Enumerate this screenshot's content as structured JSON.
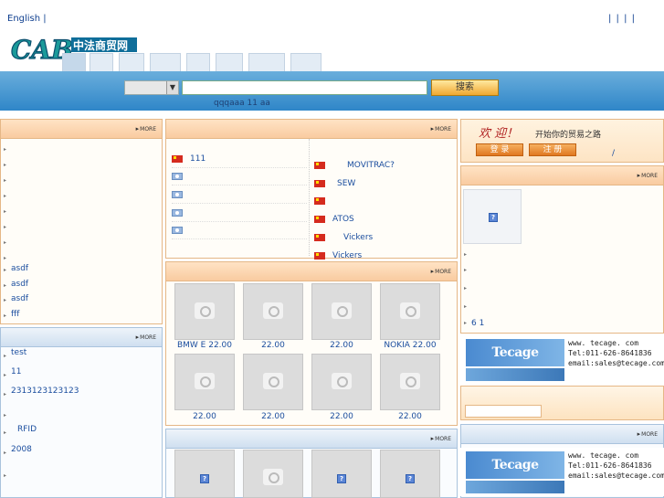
{
  "topbar": {
    "language": "English |",
    "separators": "|    |    |    |"
  },
  "logo": {
    "text": "CAB",
    "chinese": "中法商贸网"
  },
  "search": {
    "button_label": "搜索",
    "hot_words": "qqqaaa    11    aa"
  },
  "left_panel1": {
    "more": "MORE",
    "items": [
      "",
      "",
      "",
      "",
      "",
      "",
      "",
      "",
      "asdf",
      "asdf",
      "asdf",
      "fff"
    ]
  },
  "left_panel2": {
    "more": "MORE",
    "items": [
      "test",
      "11",
      "2313123123123",
      "",
      "RFID",
      "2008",
      ""
    ]
  },
  "mid_panel1": {
    "more": "MORE",
    "left_items": [
      {
        "flag": "cn",
        "text": "111"
      },
      {
        "flag": "un",
        "text": ""
      },
      {
        "flag": "un",
        "text": ""
      },
      {
        "flag": "un",
        "text": ""
      },
      {
        "flag": "un",
        "text": ""
      }
    ],
    "right_items": [
      {
        "flag": "cn",
        "text": "MOVITRAC?"
      },
      {
        "flag": "cn",
        "text": "SEW"
      },
      {
        "flag": "cn",
        "text": ""
      },
      {
        "flag": "cn",
        "text": "ATOS"
      },
      {
        "flag": "cn",
        "text": "Vickers"
      },
      {
        "flag": "cn",
        "text": "Vickers"
      }
    ]
  },
  "mid_panel2": {
    "more": "MORE",
    "products": [
      "BMW    E 22.00",
      "22.00",
      "22.00",
      "NOKIA 22.00",
      "22.00",
      "22.00",
      "22.00",
      "22.00"
    ]
  },
  "mid_panel3": {
    "more": "MORE"
  },
  "welcome": {
    "title": "欢  迎！",
    "subtitle": "开始你的贸易之路",
    "login": "登 录",
    "register": "注 册",
    "slash": "/"
  },
  "right_panel1": {
    "more": "MORE",
    "items": [
      "",
      "",
      "",
      "",
      "6 1"
    ]
  },
  "right_panel2": {
    "more": "MORE"
  },
  "ad": {
    "brand": "Tecage Corporation",
    "web": "www. tecage. com",
    "tel": "Tel:011-626-8641836",
    "email": "email:sales@tecage.com"
  }
}
